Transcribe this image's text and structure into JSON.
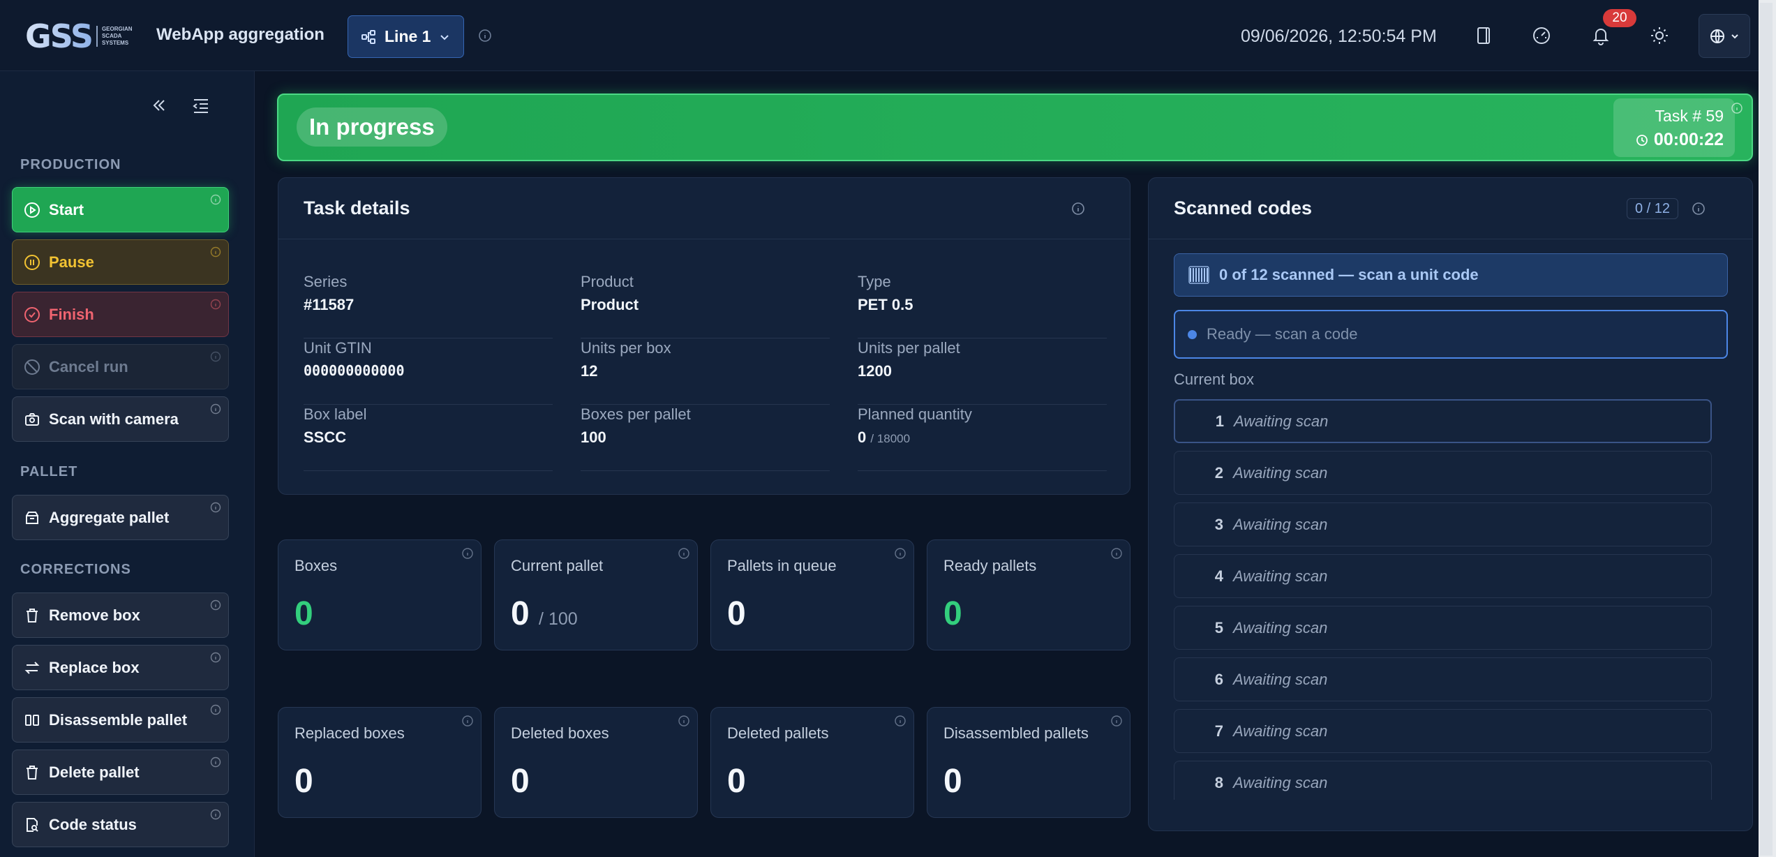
{
  "header": {
    "logo_text": "GSS",
    "logo_subtitle": "GEORGIAN SCADA SYSTEMS",
    "app_title": "WebApp aggregation",
    "line_select": "Line 1",
    "datetime": "09/06/2026, 12:50:54 PM",
    "notifications_count": "20",
    "icons": [
      "book-icon",
      "gauge-icon",
      "bell-icon",
      "sun-icon",
      "globe-icon"
    ]
  },
  "sidebar": {
    "sections": {
      "production": "PRODUCTION",
      "pallet": "PALLET",
      "corrections": "CORRECTIONS"
    },
    "buttons": {
      "start": "Start",
      "pause": "Pause",
      "finish": "Finish",
      "cancel_run": "Cancel run",
      "scan_camera": "Scan with camera",
      "aggregate_pallet": "Aggregate pallet",
      "remove_box": "Remove box",
      "replace_box": "Replace box",
      "disassemble_pallet": "Disassemble pallet",
      "delete_pallet": "Delete pallet",
      "code_status": "Code status"
    }
  },
  "status": {
    "label": "In progress",
    "task_number": "Task # 59",
    "elapsed": "00:00:22",
    "color": "#1fa653"
  },
  "task_details": {
    "title": "Task details",
    "fields": [
      {
        "label": "Series",
        "value": "#11587"
      },
      {
        "label": "Product",
        "value": "Product"
      },
      {
        "label": "Type",
        "value": "PET 0.5"
      },
      {
        "label": "Unit GTIN",
        "value": "000000000000"
      },
      {
        "label": "Units per box",
        "value": "12"
      },
      {
        "label": "Units per pallet",
        "value": "1200"
      },
      {
        "label": "Box label",
        "value": "SSCC"
      },
      {
        "label": "Boxes per pallet",
        "value": "100"
      },
      {
        "label": "Planned quantity",
        "value": "0",
        "suffix": "/ 18000"
      }
    ]
  },
  "stats": [
    {
      "label": "Boxes",
      "value": "0"
    },
    {
      "label": "Current pallet",
      "value": "0",
      "suffix": "/ 100"
    },
    {
      "label": "Pallets in queue",
      "value": "0"
    },
    {
      "label": "Ready pallets",
      "value": "0"
    },
    {
      "label": "Replaced boxes",
      "value": "0"
    },
    {
      "label": "Deleted boxes",
      "value": "0"
    },
    {
      "label": "Deleted pallets",
      "value": "0"
    },
    {
      "label": "Disassembled pallets",
      "value": "0"
    }
  ],
  "scanned": {
    "title": "Scanned codes",
    "count": "0 / 12",
    "banner": "0 of 12 scanned — scan a unit code",
    "input_placeholder": "Ready — scan a code",
    "current_box_label": "Current box",
    "slots": [
      {
        "num": "1",
        "status": "Awaiting scan"
      },
      {
        "num": "2",
        "status": "Awaiting scan"
      },
      {
        "num": "3",
        "status": "Awaiting scan"
      },
      {
        "num": "4",
        "status": "Awaiting scan"
      },
      {
        "num": "5",
        "status": "Awaiting scan"
      },
      {
        "num": "6",
        "status": "Awaiting scan"
      },
      {
        "num": "7",
        "status": "Awaiting scan"
      },
      {
        "num": "8",
        "status": "Awaiting scan"
      }
    ]
  }
}
